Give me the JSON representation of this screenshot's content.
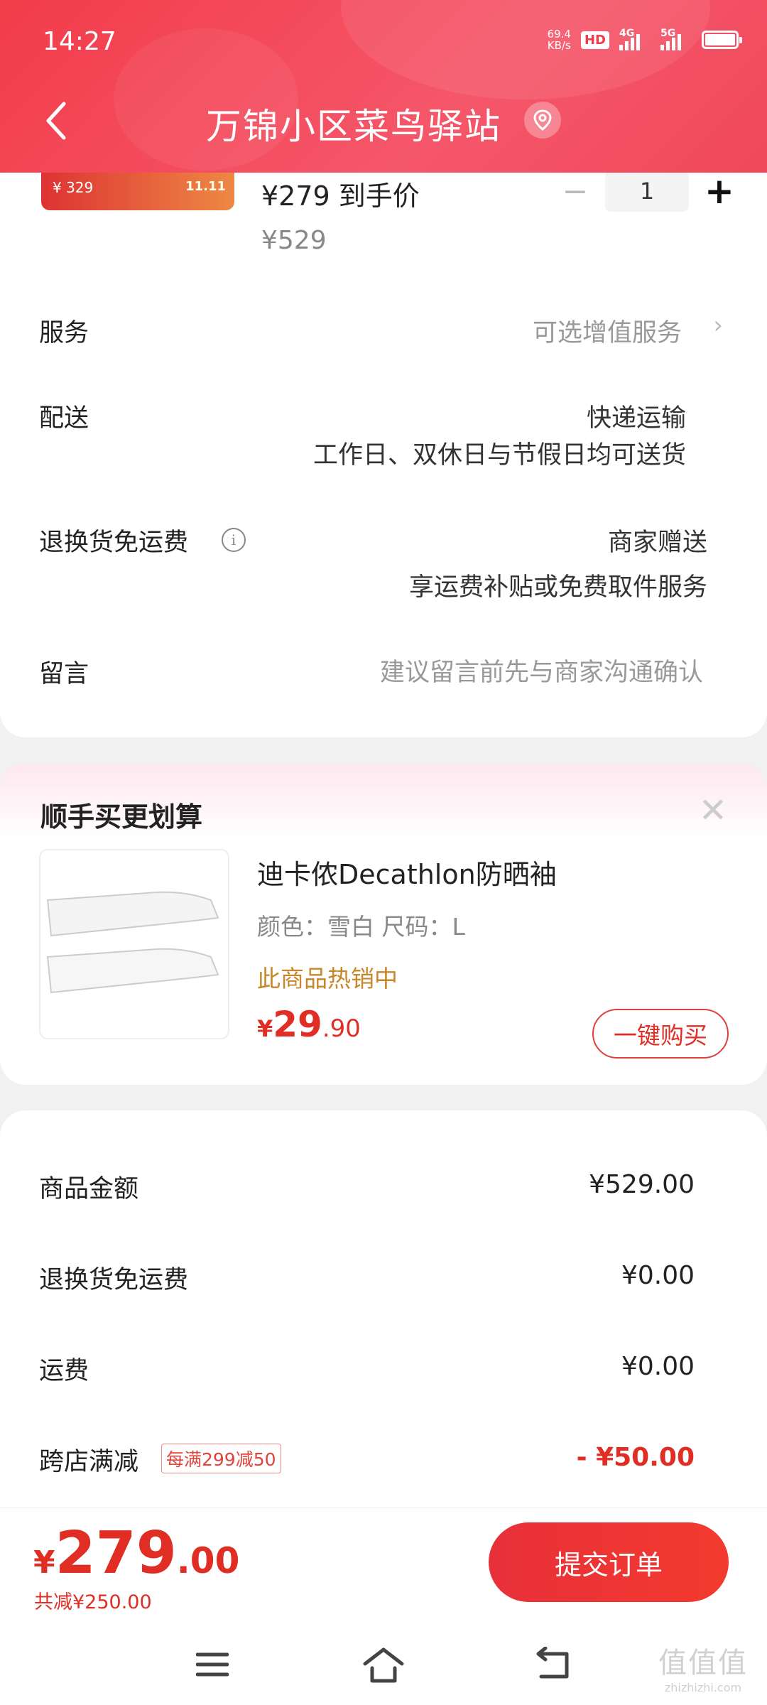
{
  "status_bar": {
    "time": "14:27",
    "net_speed_value": "69.4",
    "net_speed_unit": "KB/s",
    "hd": "HD",
    "signal1": "4G",
    "signal2": "5G"
  },
  "header": {
    "title": "万锦小区菜鸟驿站",
    "back_icon": "chevron-left-icon",
    "location_icon": "location-pin-icon"
  },
  "product": {
    "thumb_price": "¥ 329",
    "thumb_tag": "11.11",
    "price_label": "¥279 到手价",
    "original_price": "¥529",
    "quantity": "1",
    "minus": "−",
    "plus": "+"
  },
  "order_options": {
    "service_label": "服务",
    "service_value": "可选增值服务",
    "delivery_label": "配送",
    "delivery_method": "快递运输",
    "delivery_note": "工作日、双休日与节假日均可送货",
    "return_label": "退换货免运费",
    "return_value": "商家赠送",
    "return_note": "享运费补贴或免费取件服务",
    "message_label": "留言",
    "message_placeholder": "建议留言前先与商家沟通确认"
  },
  "addon": {
    "title": "顺手买更划算",
    "name": "迪卡侬Decathlon防晒袖",
    "spec": "颜色：雪白   尺码：L",
    "hot": "此商品热销中",
    "price_currency": "¥",
    "price_int": "29",
    "price_dec": ".90",
    "buy_label": "一键购买"
  },
  "summary": {
    "goods_label": "商品金额",
    "goods_value": "¥529.00",
    "return_label": "退换货免运费",
    "return_value": "¥0.00",
    "shipping_label": "运费",
    "shipping_value": "¥0.00",
    "discount_label": "跨店满减",
    "discount_tag": "每满299减50",
    "discount_value": "- ¥50.00"
  },
  "footer": {
    "total_currency": "¥",
    "total_int": "279",
    "total_dec": ".00",
    "saved": "共减¥250.00",
    "submit_label": "提交订单"
  },
  "watermark": {
    "glyphs": "值值值",
    "url": "zhizhizhi.com"
  },
  "colors": {
    "brand_red": "#f23c4a",
    "price_red": "#e02e24",
    "hot_orange": "#c8862a"
  }
}
